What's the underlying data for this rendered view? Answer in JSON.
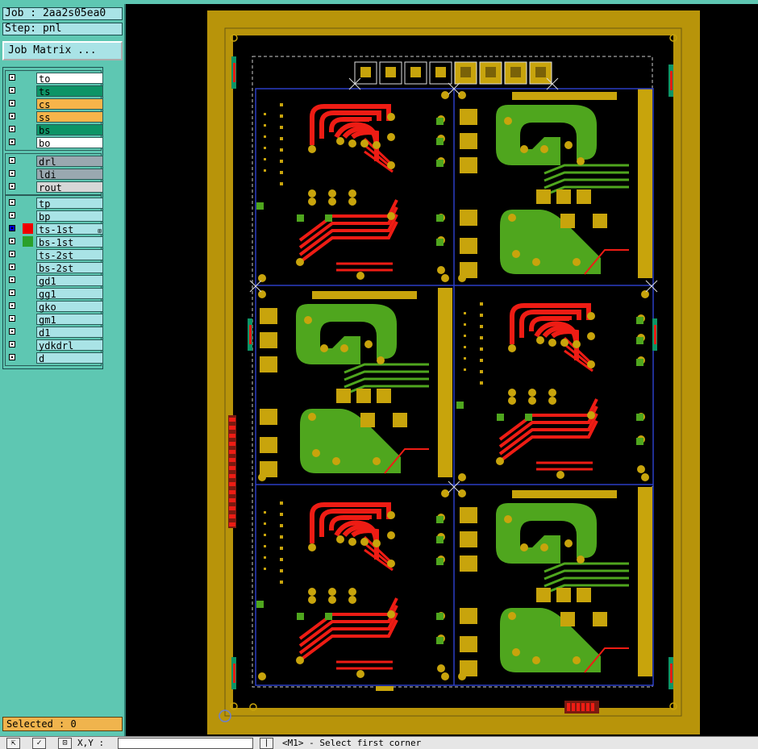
{
  "job_label": "Job : 2aa2s05ea0",
  "step_label": "Step: pnl",
  "job_matrix_label": "Job Matrix ...",
  "groups": [
    {
      "layers": [
        {
          "name": "to",
          "color": "#ffffff"
        },
        {
          "name": "ts",
          "color": "#0d9466"
        },
        {
          "name": "cs",
          "color": "#f7b44a"
        },
        {
          "name": "ss",
          "color": "#f7b44a"
        },
        {
          "name": "bs",
          "color": "#0d9466"
        },
        {
          "name": "bo",
          "color": "#ffffff"
        }
      ]
    },
    {
      "layers": [
        {
          "name": "drl",
          "color": "#9aa8b0"
        },
        {
          "name": "ldi",
          "color": "#9aa8b0"
        },
        {
          "name": "rout",
          "color": "#d7d7d7"
        }
      ]
    },
    {
      "layers": [
        {
          "name": "tp",
          "color": "#a9e3e6"
        },
        {
          "name": "bp",
          "color": "#a9e3e6"
        },
        {
          "name": "ts-1st",
          "color": "#a9e3e6",
          "swatch": "#ee0000",
          "marker": "#0000cc",
          "scroll": "⊞"
        },
        {
          "name": "bs-1st",
          "color": "#a9e3e6",
          "swatch": "#2aa02a"
        },
        {
          "name": "ts-2st",
          "color": "#a9e3e6"
        },
        {
          "name": "bs-2st",
          "color": "#a9e3e6"
        },
        {
          "name": "gd1",
          "color": "#a9e3e6"
        },
        {
          "name": "gg1",
          "color": "#a9e3e6"
        },
        {
          "name": "gko",
          "color": "#a9e3e6"
        },
        {
          "name": "gm1",
          "color": "#a9e3e6"
        },
        {
          "name": "d1",
          "color": "#a9e3e6"
        },
        {
          "name": "ydkdrl",
          "color": "#a9e3e6"
        },
        {
          "name": "d",
          "color": "#a9e3e6"
        }
      ]
    }
  ],
  "selected_status": "Selected : 0",
  "bottom": {
    "coord_label": "X,Y :",
    "prompt": "<M1> - Select first corner",
    "buttons": [
      "⇱",
      "✓",
      "⊡"
    ],
    "end_button": "|"
  },
  "colors": {
    "gold": "#b8940a",
    "copper": "#c8a40c",
    "trace_red": "#ee1c14",
    "pad_green": "#4fa61e",
    "outline_blue": "#2b3ec4"
  }
}
